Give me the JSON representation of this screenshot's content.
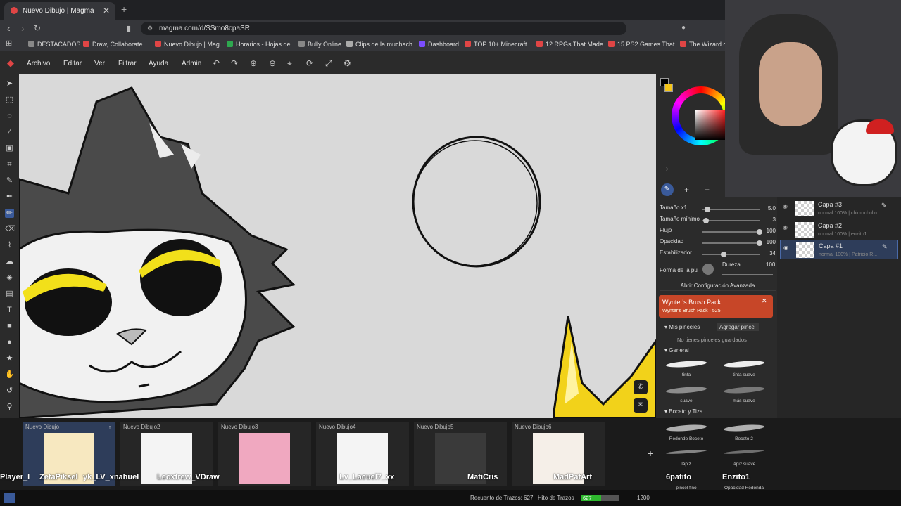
{
  "browser": {
    "tab_title": "Nuevo Dibujo | Magma",
    "url": "magma.com/d/SSmo8cpaSR",
    "bookmarks": [
      {
        "label": "DESTACADOS",
        "color": "#888888"
      },
      {
        "label": "Draw, Collaborate...",
        "color": "#e04545"
      },
      {
        "label": "Nuevo Dibujo | Mag...",
        "color": "#e04545"
      },
      {
        "label": "Horarios - Hojas de...",
        "color": "#2ea84f"
      },
      {
        "label": "Bully Online",
        "color": "#888888"
      },
      {
        "label": "Clips de la muchach...",
        "color": "#aaaaaa"
      },
      {
        "label": "Dashboard",
        "color": "#7b4dff"
      },
      {
        "label": "TOP 10+ Minecraft...",
        "color": "#e04545"
      },
      {
        "label": "12 RPGs That Made...",
        "color": "#e04545"
      },
      {
        "label": "15 PS2 Games That...",
        "color": "#e04545"
      },
      {
        "label": "The Wizard of",
        "color": "#e04545"
      }
    ]
  },
  "menu": [
    "Archivo",
    "Editar",
    "Ver",
    "Filtrar",
    "Ayuda",
    "Admin"
  ],
  "brush_panel": {
    "sliders": [
      {
        "label": "Tamaño x1",
        "value": "5.0",
        "level": 0.05
      },
      {
        "label": "Tamaño mínimo",
        "value": "3",
        "level": 0.03
      },
      {
        "label": "Flujo",
        "value": "100",
        "level": 1.0
      },
      {
        "label": "Opacidad",
        "value": "100",
        "level": 1.0
      },
      {
        "label": "Estabilizador",
        "value": "34",
        "level": 0.34
      }
    ],
    "shape_label": "Forma de la pu",
    "hardness_label": "Dureza",
    "hardness_value": "100",
    "advanced_button": "Abrir Configuración Avanzada",
    "pack_title": "Wynter's Brush Pack",
    "pack_subtitle": "Wynter's Brush Pack · 525",
    "my_brushes": "Mis pinceles",
    "add_brush": "Agregar pincel",
    "no_brushes": "No tienes pinceles guardados",
    "general_title": "General",
    "general_brushes": [
      "tinta",
      "tinta suave",
      "suave",
      "más suave"
    ],
    "sketch_title": "Boceto y Tiza",
    "sketch_brushes": [
      "Redondo Boceto",
      "Boceto 2",
      "lápiz",
      "lápiz suave"
    ],
    "extra_brushes": [
      "pincel fino",
      "Opacidad Redonda"
    ]
  },
  "layers": [
    {
      "name": "Capa #3",
      "desc": "normal 100% | chimnchulin"
    },
    {
      "name": "Capa #2",
      "desc": "normal 100% | enzito1"
    },
    {
      "name": "Capa #1",
      "desc": "normal 100% | Patricio R..."
    }
  ],
  "documents": [
    {
      "title": "Nuevo Dibujo",
      "user": "ZetaPiksel"
    },
    {
      "title": "Nuevo Dibujo2",
      "user": "Leoxtrew_VDraw"
    },
    {
      "title": "Nuevo Dibujo3",
      "user": ""
    },
    {
      "title": "Nuevo Dibujo4",
      "user": "Lv_Lacuel7_xx"
    },
    {
      "title": "Nuevo Dibujo5",
      "user": "MatiCris"
    },
    {
      "title": "Nuevo Dibujo6",
      "user": "MadPatArt"
    }
  ],
  "overlay_users": [
    "Player_I",
    "yk_LV_xnahuel",
    "6patito",
    "Enzito1"
  ],
  "status": {
    "strokes_label": "Recuento de Trazos: 627",
    "milestone_label": "Hito de Trazos",
    "current": "627",
    "goal": "1200",
    "progress": 0.52
  },
  "colors": {
    "primary": "#000000",
    "secondary": "#f5c518"
  }
}
